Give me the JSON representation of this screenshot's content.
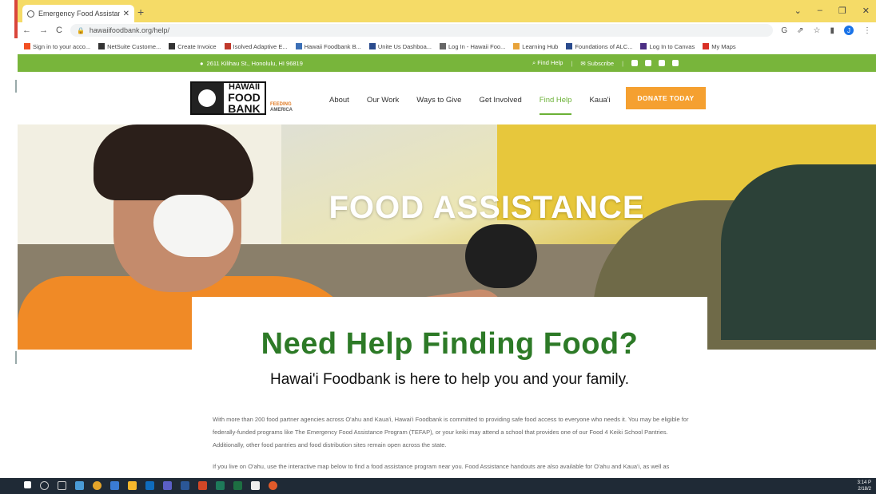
{
  "browser": {
    "tab_title": "Emergency Food Assistance - Ha",
    "url": "hawaiifoodbank.org/help/",
    "bookmarks": [
      "Sign in to your acco...",
      "NetSuite Custome...",
      "Create Invoice",
      "Isolved Adaptive E...",
      "Hawaii Foodbank B...",
      "Unite Us Dashboa...",
      "Log In - Hawaii Foo...",
      "Learning Hub",
      "Foundations of ALC...",
      "Log In to Canvas",
      "My Maps"
    ]
  },
  "topbar": {
    "address": "2611 Kilihau St., Honolulu, HI 96819",
    "find_help": "Find Help",
    "subscribe": "Subscribe"
  },
  "nav": {
    "logo": [
      "HAWAII",
      "FOOD",
      "BANK"
    ],
    "feeding": "FEEDING",
    "america": "AMERICA",
    "items": [
      "About",
      "Our Work",
      "Ways to Give",
      "Get Involved",
      "Find Help",
      "Kaua'i"
    ],
    "donate": "DONATE TODAY"
  },
  "hero": {
    "title": "FOOD ASSISTANCE"
  },
  "content": {
    "heading": "Need Help Finding Food?",
    "subheading": "Hawai'i Foodbank is here to help you and your family.",
    "para1": "With more than 200 food partner agencies across O'ahu and Kaua'i, Hawai'i Foodbank is committed to providing safe food access to everyone who needs it. You may be eligible for federally-funded programs like The Emergency Food Assistance Program (TEFAP), or your keiki may attend a school that provides one of our Food 4 Keiki School Pantries. Additionally, other food pantries and food distribution sites remain open across the state.",
    "para2": "If you live on O'ahu, use the interactive map below to find a food assistance program near you. Food Assistance handouts are also available for O'ahu and Kaua'i, as well as"
  },
  "taskbar": {
    "time": "3:14 P",
    "date": "2/18/2"
  },
  "colors": {
    "green": "#78b53b",
    "orange": "#f5a030",
    "heading_green": "#2d7a27",
    "tab_yellow": "#f5db67"
  }
}
